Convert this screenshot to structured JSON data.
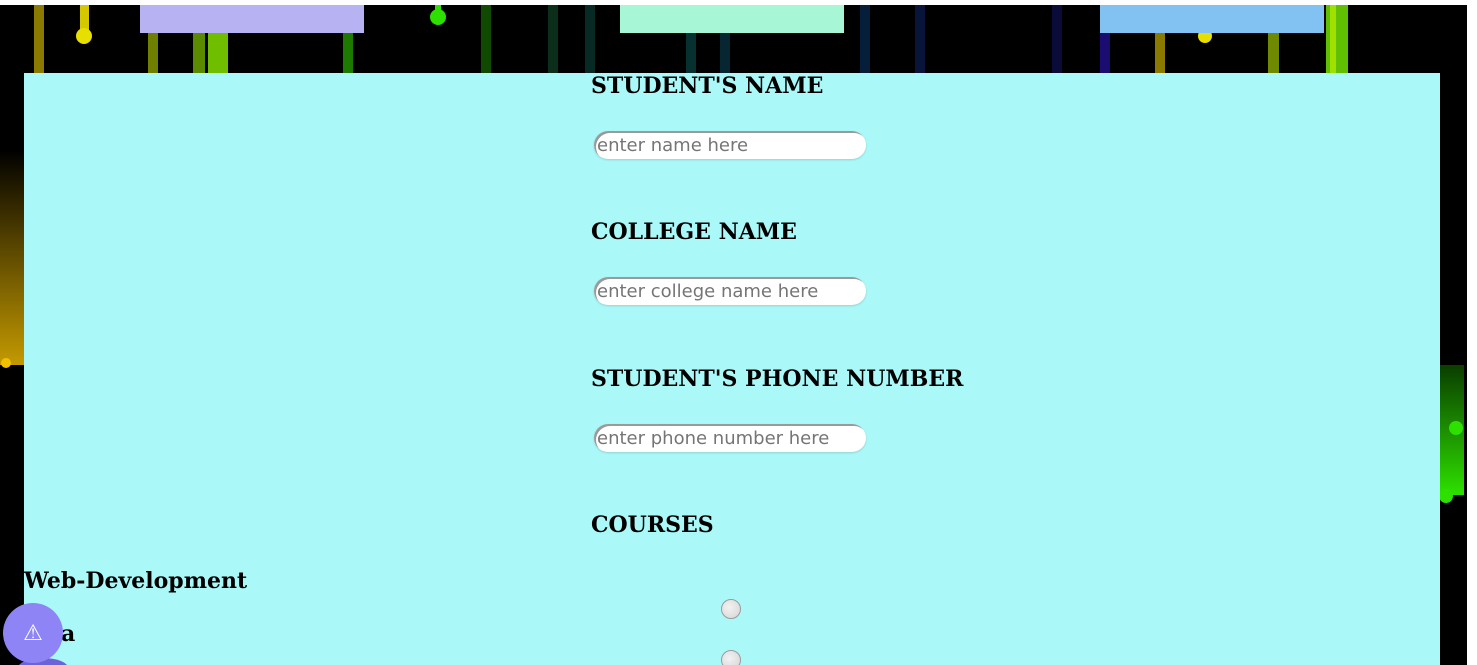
{
  "colors": {
    "panel": "#abf8f8",
    "top_bars": [
      "#b7b3f2",
      "#a7f7d6",
      "#82c2f3"
    ],
    "fab": "#8e84f6"
  },
  "form": {
    "fields": [
      {
        "label": "STUDENT'S NAME",
        "placeholder": "enter name here"
      },
      {
        "label": "COLLEGE NAME",
        "placeholder": "enter college name here"
      },
      {
        "label": "STUDENT'S PHONE NUMBER",
        "placeholder": "enter phone number here"
      }
    ],
    "courses_heading": "COURSES",
    "courses": [
      {
        "label": "Web-Development",
        "selected": false
      },
      {
        "label": "a",
        "selected": false
      }
    ]
  },
  "fab": {
    "icon": "warning-icon",
    "glyph": "⚠"
  }
}
